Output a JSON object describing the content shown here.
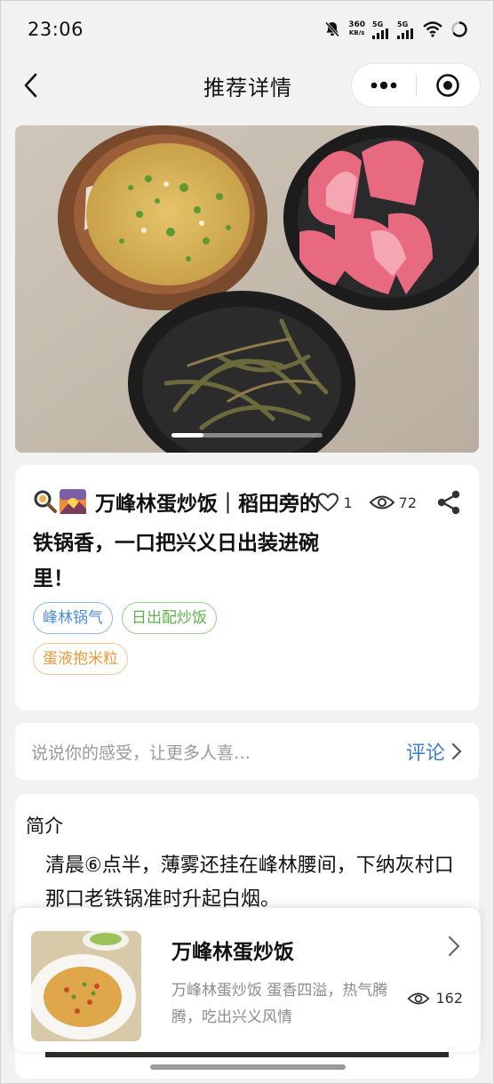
{
  "status_bar": {
    "time": "23:06",
    "net_speed_value": "360",
    "net_speed_unit": "KB/s",
    "sim1": "5G",
    "sim2": "5G",
    "icons": [
      "bell-muted-icon",
      "signal-icon",
      "signal-icon",
      "wifi-icon",
      "battery-icon"
    ]
  },
  "nav": {
    "title": "推荐详情",
    "icons": [
      "back-icon",
      "more-dots-icon",
      "record-target-icon"
    ]
  },
  "carousel": {
    "image_desc_icon": "food-photo",
    "active_index": 1,
    "total": 5
  },
  "post": {
    "title": "万峰林蛋炒饭｜稻田旁的铁锅香，一口把兴义日出装进碗里！",
    "title_icons": [
      "magnifier-emoji-icon",
      "sunrise-emoji-icon"
    ],
    "likes": "1",
    "views": "72",
    "tags": [
      {
        "label": "峰林锅气",
        "color": "#4a8fd8"
      },
      {
        "label": "日出配炒饭",
        "color": "#5cb14b"
      },
      {
        "label": "蛋液抱米粒",
        "color": "#e89a3c"
      }
    ]
  },
  "comment": {
    "placeholder": "说说你的感受，让更多人喜…",
    "button_label": "评论"
  },
  "intro": {
    "heading": "简介",
    "text": "清晨⑥点半，薄雾还挂在峰林腰间，下纳灰村口那口老铁锅准时升起白烟。"
  },
  "related": {
    "title": "万峰林蛋炒饭",
    "description": "万峰林蛋炒饭 蛋香四溢，热气腾腾，吃出兴义风情",
    "views": "162"
  },
  "colors": {
    "accent_blue": "#3d7fc8",
    "background": "#f2f2f2"
  }
}
